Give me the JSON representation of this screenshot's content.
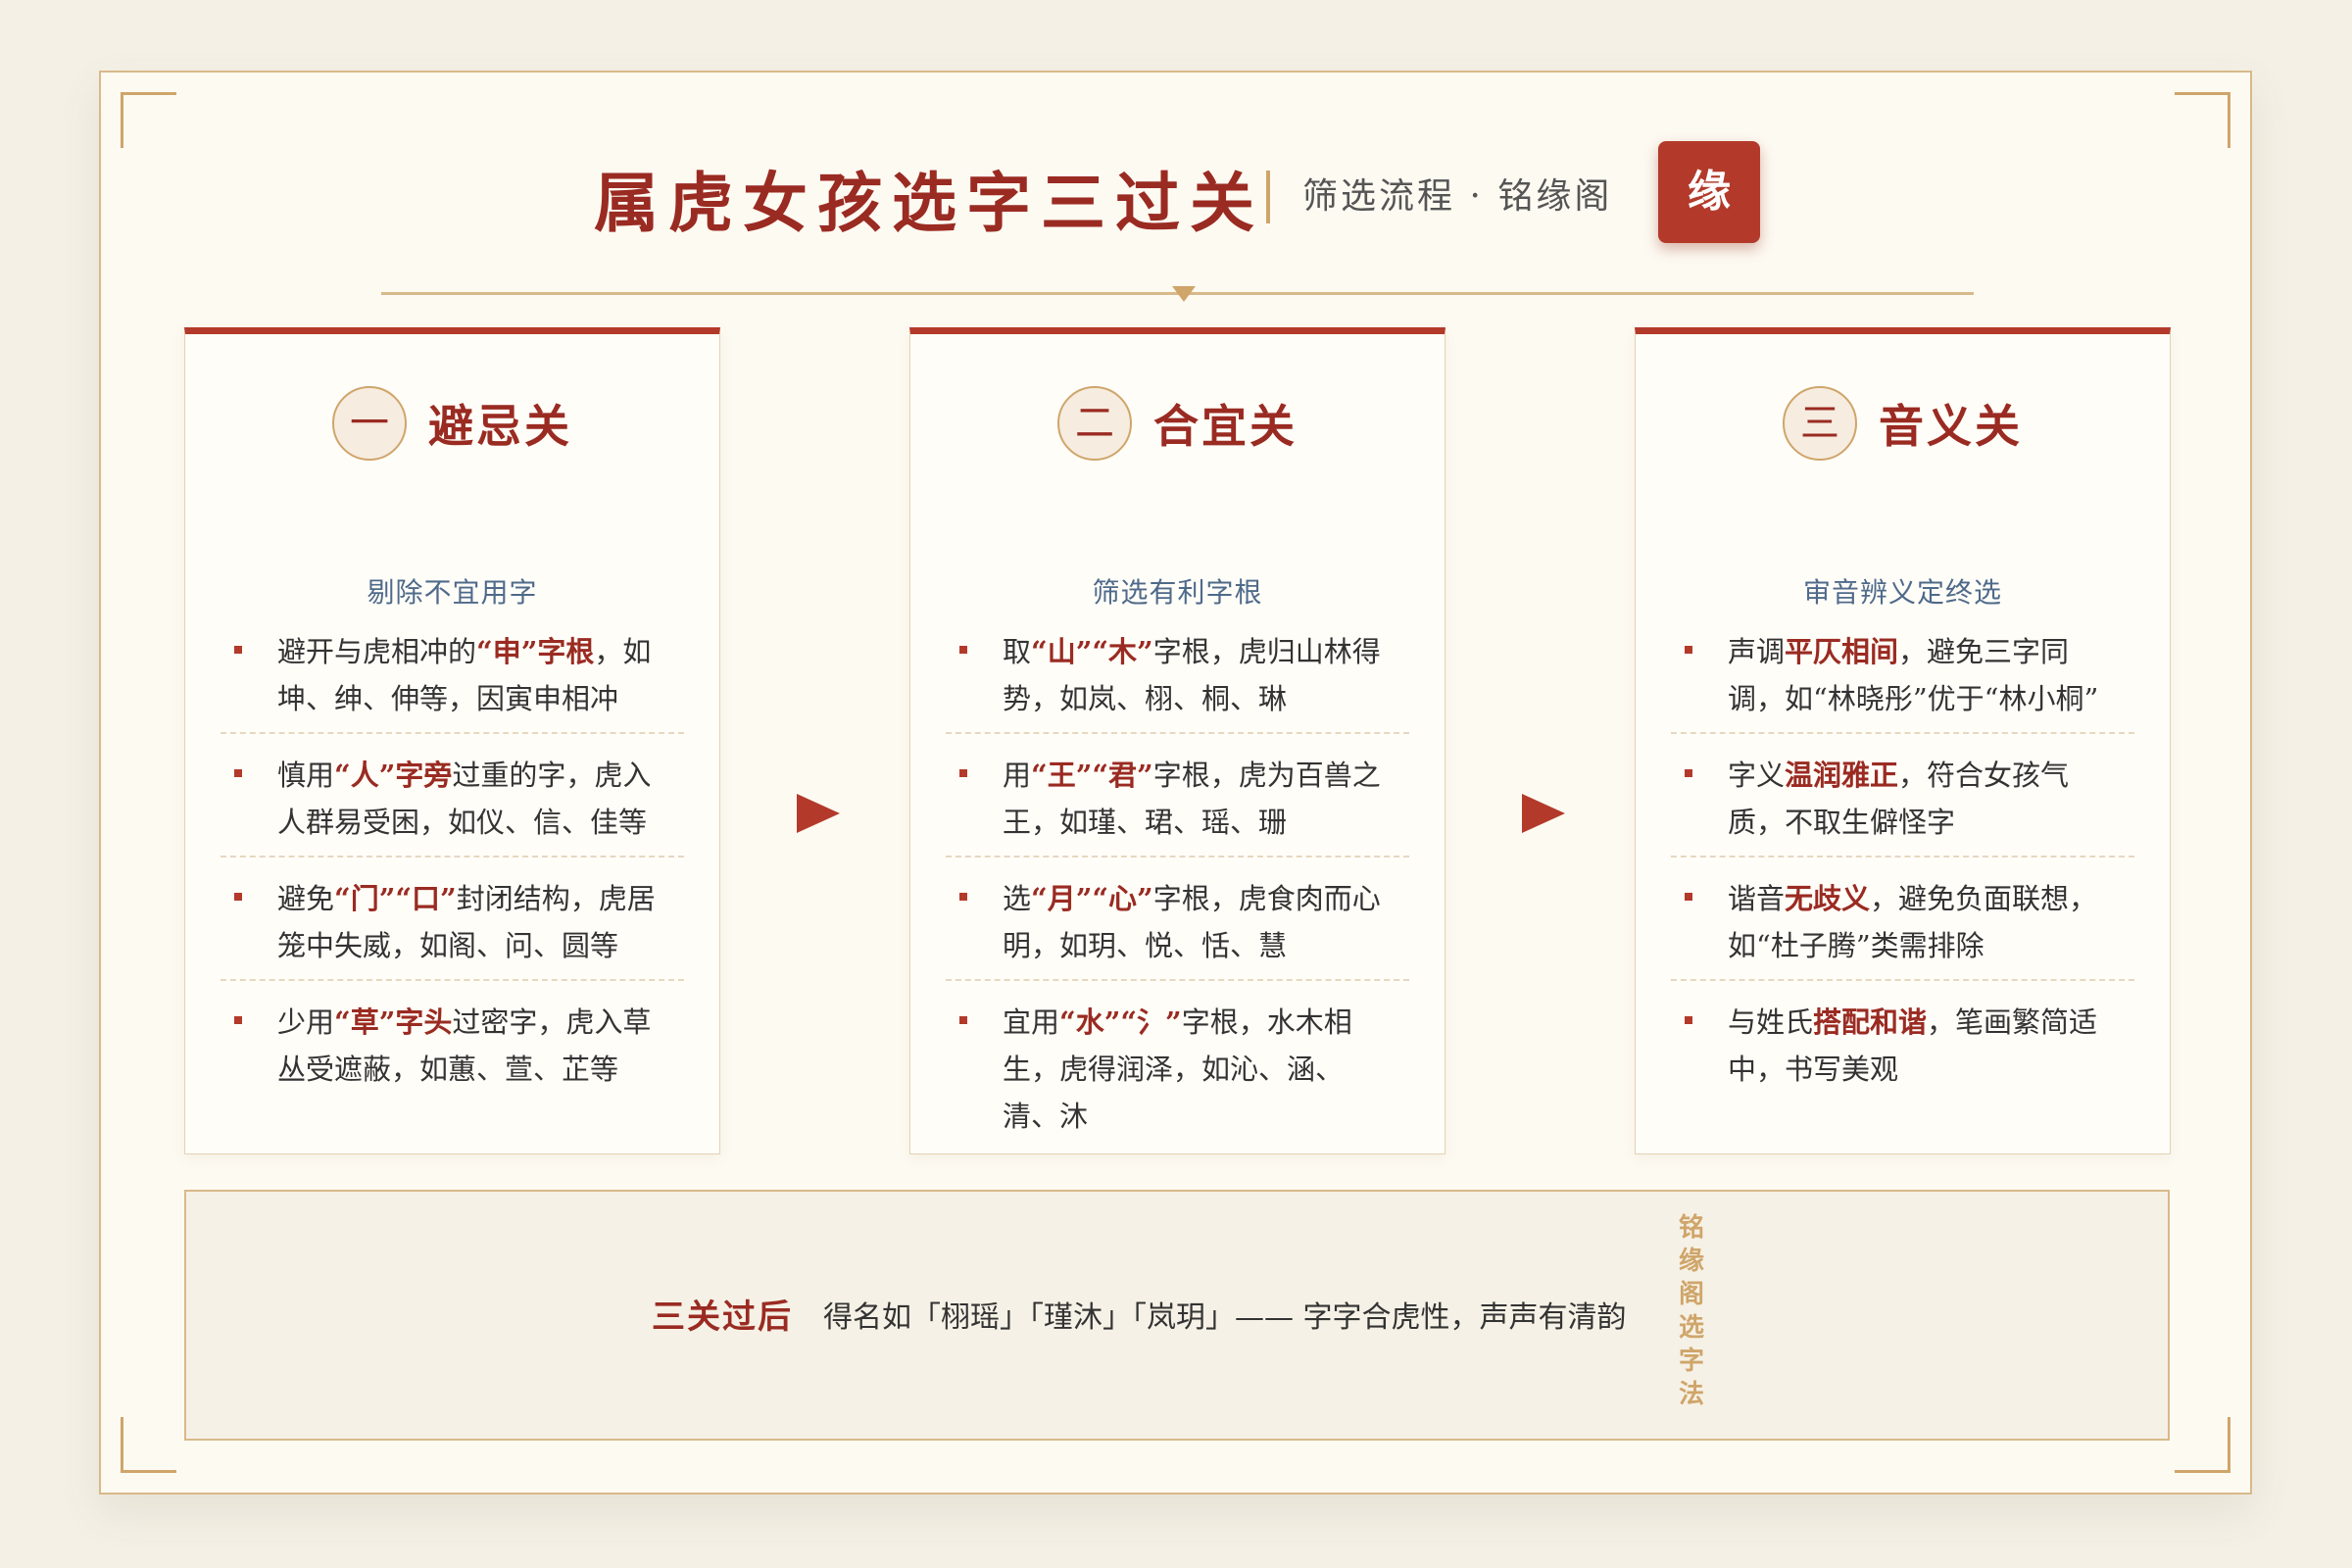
{
  "header": {
    "title": "属虎女孩选字三过关",
    "subtitle": "筛选流程 · 铭缘阁",
    "seal": "缘"
  },
  "cards": [
    {
      "num": "一",
      "title": "避忌关",
      "sub": "剔除不宜用字",
      "items": [
        {
          "pre": "避开与虎相冲的",
          "hl": "“申”字根",
          "post": "，如坤、绅、伸等，因寅申相冲"
        },
        {
          "pre": "慎用",
          "hl": "“人”字旁",
          "post": "过重的字，虎入人群易受困，如仪、信、佳等"
        },
        {
          "pre": "避免",
          "hl": "“门”“口”",
          "post": "封闭结构，虎居笼中失威，如阁、问、圆等"
        },
        {
          "pre": "少用",
          "hl": "“草”字头",
          "post": "过密字，虎入草丛受遮蔽，如蕙、萱、芷等"
        }
      ]
    },
    {
      "num": "二",
      "title": "合宜关",
      "sub": "筛选有利字根",
      "items": [
        {
          "pre": "取",
          "hl": "“山”“木”",
          "post": "字根，虎归山林得势，如岚、栩、桐、琳"
        },
        {
          "pre": "用",
          "hl": "“王”“君”",
          "post": "字根，虎为百兽之王，如瑾、珺、瑶、珊"
        },
        {
          "pre": "选",
          "hl": "“月”“心”",
          "post": "字根，虎食肉而心明，如玥、悦、恬、慧"
        },
        {
          "pre": "宜用",
          "hl": "“水”“氵”",
          "post": "字根，水木相生，虎得润泽，如沁、涵、清、沐"
        }
      ]
    },
    {
      "num": "三",
      "title": "音义关",
      "sub": "审音辨义定终选",
      "items": [
        {
          "pre": "声调",
          "hl": "平仄相间",
          "post": "，避免三字同调，如“林晓彤”优于“林小桐”"
        },
        {
          "pre": "字义",
          "hl": "温润雅正",
          "post": "，符合女孩气质，不取生僻怪字"
        },
        {
          "pre": "谐音",
          "hl": "无歧义",
          "post": "，避免负面联想，如“杜子腾”类需排除"
        },
        {
          "pre": "与姓氏",
          "hl": "搭配和谐",
          "post": "，笔画繁简适中，书写美观"
        }
      ]
    }
  ],
  "bottom": {
    "label": "三关过后",
    "text": "得名如「栩瑶」「瑾沐」「岚玥」—— 字字合虎性，声声有清韵",
    "vertical": "铭缘阁选字法"
  },
  "colors": {
    "accent": "#b33a2a",
    "title": "#9a2b22",
    "gold": "#cfa56a",
    "sub": "#4f6a8a",
    "background": "#fdfaf2"
  }
}
